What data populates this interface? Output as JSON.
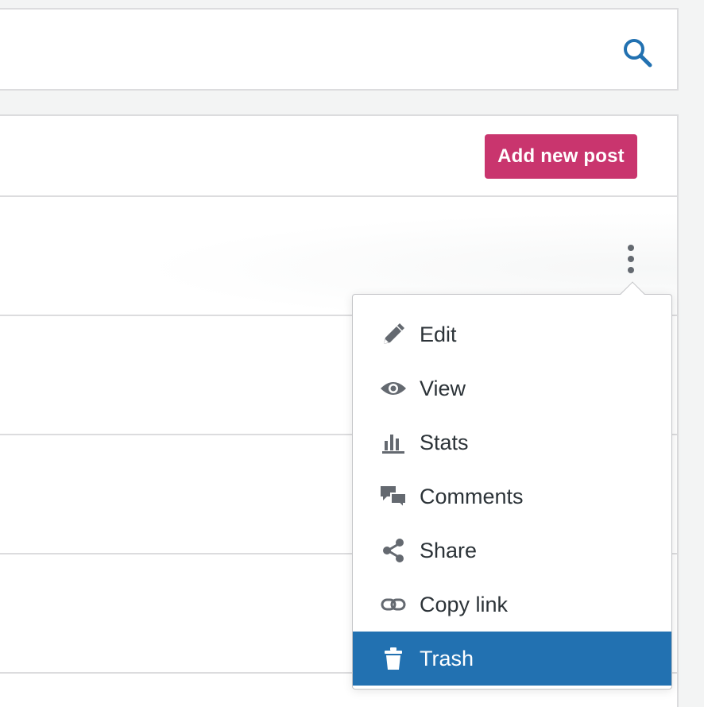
{
  "search": {
    "icon": "search-icon",
    "accent": "#2271b1"
  },
  "posts": {
    "add_new_label": "Add new post",
    "add_new_color": "#c9356e"
  },
  "post_menu": {
    "items": [
      {
        "label": "Edit",
        "icon": "pencil-icon"
      },
      {
        "label": "View",
        "icon": "eye-icon"
      },
      {
        "label": "Stats",
        "icon": "stats-icon"
      },
      {
        "label": "Comments",
        "icon": "comments-icon"
      },
      {
        "label": "Share",
        "icon": "share-icon"
      },
      {
        "label": "Copy link",
        "icon": "link-icon"
      },
      {
        "label": "Trash",
        "icon": "trash-icon",
        "highlighted": true
      }
    ],
    "highlight_color": "#2271b1"
  }
}
